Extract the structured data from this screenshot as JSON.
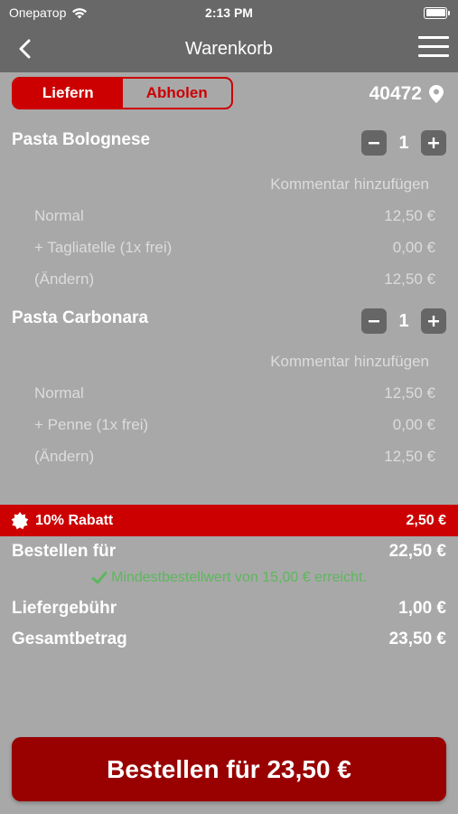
{
  "status_bar": {
    "carrier": "Оператор",
    "time": "2:13 PM"
  },
  "nav": {
    "title": "Warenkorb",
    "back_icon": "chevron-left-icon",
    "menu_icon": "hamburger-menu-icon"
  },
  "delivery_mode": {
    "options": [
      "Liefern",
      "Abholen"
    ],
    "selected": "Liefern"
  },
  "postcode": "40472",
  "cart": {
    "comment_label": "Kommentar hinzufügen",
    "items": [
      {
        "name": "Pasta Bolognese",
        "quantity": "1",
        "lines": [
          {
            "label": "Normal",
            "price": "12,50 €"
          },
          {
            "label": "+ Tagliatelle (1x frei)",
            "price": "0,00 €"
          },
          {
            "label": "(Ändern)",
            "price": "12,50 €"
          }
        ]
      },
      {
        "name": "Pasta Carbonara",
        "quantity": "1",
        "lines": [
          {
            "label": "Normal",
            "price": "12,50 €"
          },
          {
            "label": "+ Penne (1x frei)",
            "price": "0,00 €"
          },
          {
            "label": "(Ändern)",
            "price": "12,50 €"
          }
        ]
      }
    ]
  },
  "discount": {
    "label": "10% Rabatt",
    "amount": "2,50 €"
  },
  "summary": {
    "order_for_label": "Bestellen für",
    "order_for_amount": "22,50 €",
    "minimum_note": "Mindestbestellwert von 15,00 € erreicht.",
    "delivery_fee_label": "Liefergebühr",
    "delivery_fee_amount": "1,00 €",
    "total_label": "Gesamtbetrag",
    "total_amount": "23,50 €"
  },
  "order_button": {
    "label": "Bestellen für 23,50 €"
  },
  "colors": {
    "accent_red": "#cc0000",
    "button_dark_red": "#990000",
    "success_green": "#5cb85c",
    "background_gray": "#a8a8a8"
  }
}
